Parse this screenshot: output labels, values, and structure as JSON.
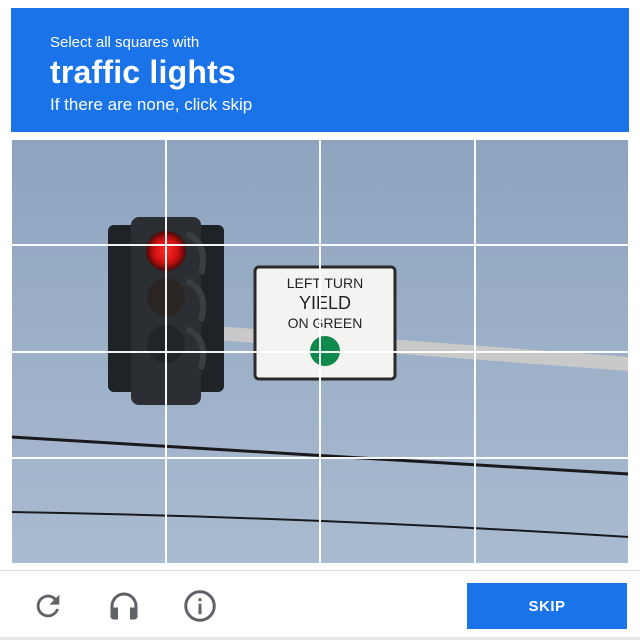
{
  "header": {
    "subtitle": "Select all squares with",
    "target": "traffic lights",
    "hint": "If there are none, click skip",
    "background": "#1a73e8"
  },
  "grid": {
    "rows": 4,
    "cols": 4,
    "sign": {
      "line1": "LEFT TURN",
      "line2": "YIELD",
      "line3": "ON GREEN"
    }
  },
  "footer": {
    "icons": [
      "reload-icon",
      "audio-challenge-icon",
      "info-icon"
    ],
    "skip_label": "SKIP"
  }
}
